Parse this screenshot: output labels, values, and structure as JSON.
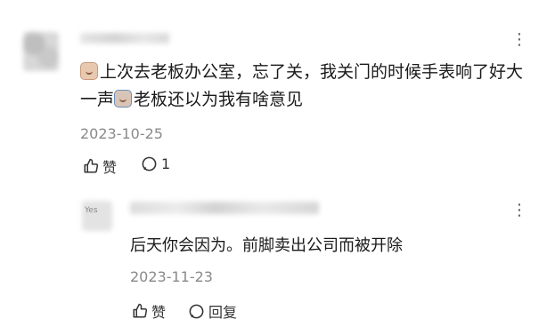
{
  "comments": [
    {
      "text_part1": "上次去老板办公室，忘了关，我关门的时候手表响了好大一声",
      "text_part2": "老板还以为我有啥意见",
      "date": "2023-10-25",
      "like_label": "赞",
      "reply_count": "1",
      "icons": [
        "thumbs-up-icon",
        "comment-icon",
        "more-icon"
      ]
    },
    {
      "avatar_text": "Yes",
      "text": "后天你会因为。前脚卖出公司而被开除",
      "date": "2023-11-23",
      "like_label": "赞",
      "reply_label": "回复",
      "icons": [
        "thumbs-up-icon",
        "comment-icon",
        "more-icon"
      ]
    }
  ],
  "more_glyph": "⋮"
}
